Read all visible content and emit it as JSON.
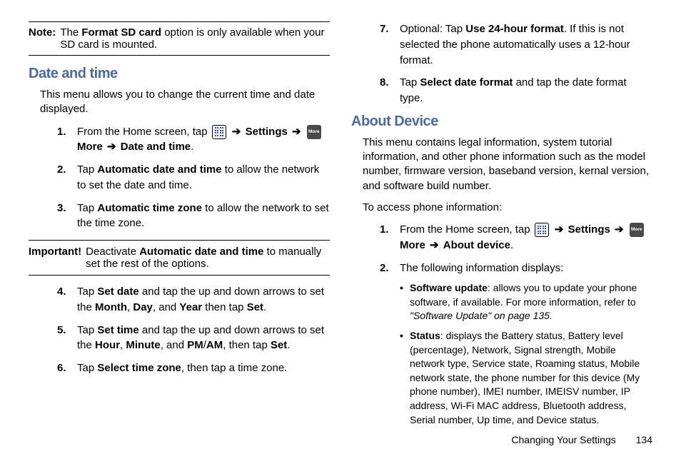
{
  "noteLabel": "Note:",
  "notePrefix": "The ",
  "noteBold": "Format SD card",
  "noteSuffix": " option is only available when your SD card is mounted.",
  "heading1": "Date and time",
  "intro1": "This menu allows you to change the current time and date displayed.",
  "sA": {
    "n1": "1.",
    "t1a": "From the Home screen, tap ",
    "t1settings": "Settings",
    "t1more": "More",
    "t1target": "Date and time",
    "n2": "2.",
    "t2a": "Tap ",
    "t2b": "Automatic date and time",
    "t2c": " to allow the network to set the date and time.",
    "n3": "3.",
    "t3a": "Tap ",
    "t3b": "Automatic time zone",
    "t3c": " to allow the network to set the time zone."
  },
  "importantLabel": "Important!",
  "importantA": "Deactivate ",
  "importantB": "Automatic date and time",
  "importantC": " to manually set the rest of the options.",
  "sB": {
    "n4": "4.",
    "t4a": "Tap ",
    "t4b": "Set date",
    "t4c": " and tap the up and down arrows to set the ",
    "t4d": "Month",
    "t4e": ", ",
    "t4f": "Day",
    "t4g": ", and ",
    "t4h": "Year",
    "t4i": " then tap ",
    "t4j": "Set",
    "t4k": ".",
    "n5": "5.",
    "t5a": "Tap ",
    "t5b": "Set time",
    "t5c": " and tap the up and down arrows to set the ",
    "t5d": "Hour",
    "t5e": ", ",
    "t5f": "Minute",
    "t5g": ", and ",
    "t5h": "PM",
    "t5i": "/",
    "t5j": "AM",
    "t5k": ", then tap ",
    "t5l": "Set",
    "t5m": ".",
    "n6": "6.",
    "t6a": "Tap ",
    "t6b": "Select time zone",
    "t6c": ", then tap a time zone."
  },
  "sC": {
    "n7": "7.",
    "t7a": "Optional: Tap ",
    "t7b": "Use 24-hour format",
    "t7c": ". If this is not selected the phone automatically uses a 12-hour format.",
    "n8": "8.",
    "t8a": "Tap ",
    "t8b": "Select date format",
    "t8c": " and tap the date format type."
  },
  "heading2": "About Device",
  "intro2a": "This menu contains legal information, system tutorial information, and other phone information such as the model number, firmware version, baseband version, kernal version, and software build number.",
  "intro2b": "To access phone information:",
  "sD": {
    "n1": "1.",
    "t1a": "From the Home screen, tap ",
    "t1settings": "Settings",
    "t1more": "More",
    "t1target": "About device",
    "n2": "2.",
    "t2": "The following information displays:"
  },
  "sub": {
    "b1a": "Software update",
    "b1b": ": allows you to update your phone software, if available. For more information, refer to ",
    "b1c": "\"Software Update\" on page 135.",
    "b2a": "Status",
    "b2b": ": displays the Battery status, Battery level (percentage), Network, Signal strength, Mobile network type, Service state, Roaming status, Mobile network state, the phone number for this device (My phone number), IMEI number, IMEISV number, IP address, Wi-Fi MAC address, Bluetooth address, Serial number, Up time, and Device status."
  },
  "footerTitle": "Changing Your Settings",
  "footerPage": "134",
  "arrow": "➔",
  "moreIconText": "More",
  "dot": "•"
}
